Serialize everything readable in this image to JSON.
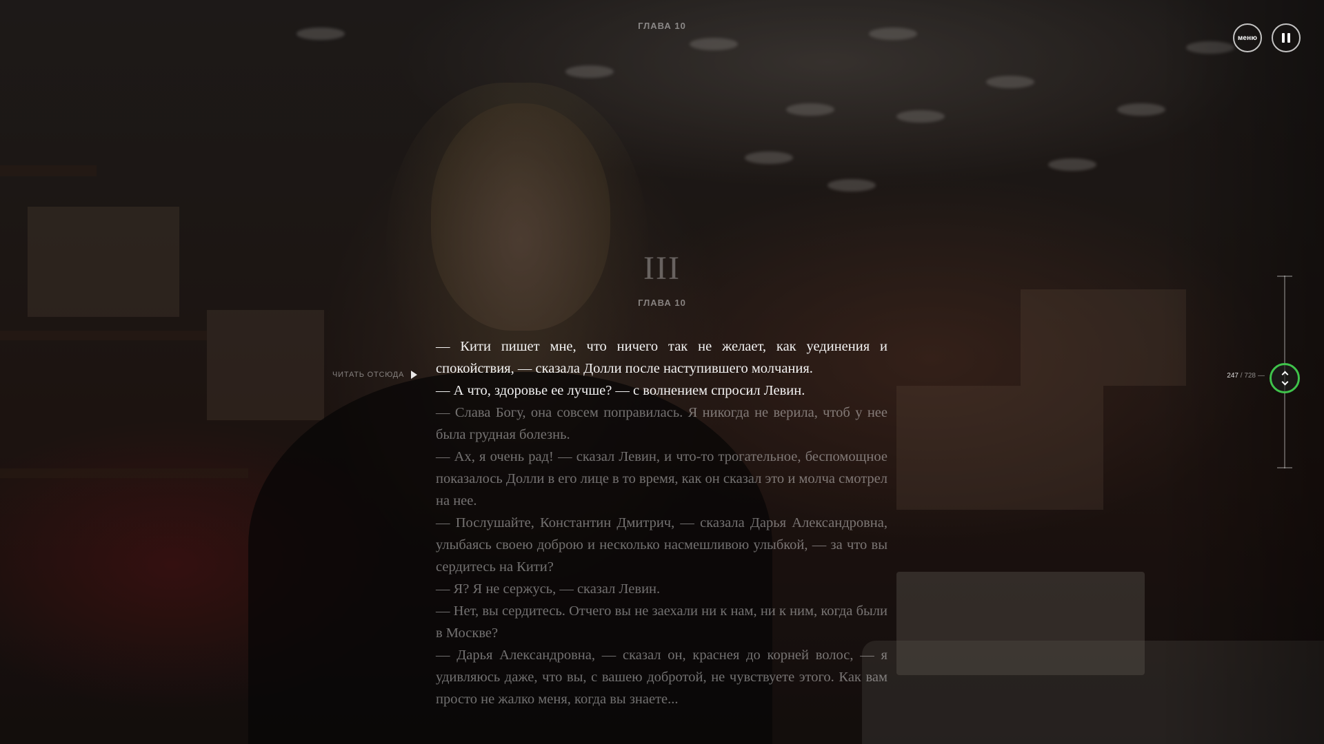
{
  "header": {
    "chapter_label": "ГЛАВА 10"
  },
  "controls": {
    "menu_label": "меню"
  },
  "section": {
    "part_number": "III",
    "chapter_label": "ГЛАВА 10"
  },
  "read_from": {
    "label": "ЧИТАТЬ ОТСЮДА"
  },
  "paragraphs": [
    "— Кити пишет мне, что ничего так не желает, как уединения и спокойствия, — сказала Долли после наступившего молчания.",
    "— А что, здоровье ее лучше? — с волнением спросил Левин.",
    "— Слава Богу, она совсем поправилась. Я никогда не верила, чтоб у нее была грудная болезнь.",
    "— Ах, я очень рад! — сказал Левин, и что-то трогательное, беспомощное показалось Долли в его лице в то время, как он сказал это и молча смотрел на нее.",
    "— Послушайте, Константин Дмитрич, — сказала Дарья Александровна, улыбаясь своею доброю и несколько насмешливою улыбкой, — за что вы сердитесь на Кити?",
    "— Я? Я не сержусь, — сказал Левин.",
    "— Нет, вы сердитесь. Отчего вы не заехали ни к нам, ни к ним, когда были в Москве?",
    "— Дарья Александровна, — сказал он, краснея до корней волос, — я удивляюсь даже, что вы, с вашею добротой, не чувствуете этого. Как вам просто не жалко меня, когда вы знаете..."
  ],
  "pagination": {
    "current": "247",
    "separator": "/",
    "total": "728",
    "dash": "—"
  },
  "colors": {
    "accent": "#3fc34b"
  },
  "icons": {
    "pause": "pause-icon",
    "play": "play-icon",
    "scroll_up": "chevron-up-icon",
    "scroll_down": "chevron-down-icon"
  }
}
